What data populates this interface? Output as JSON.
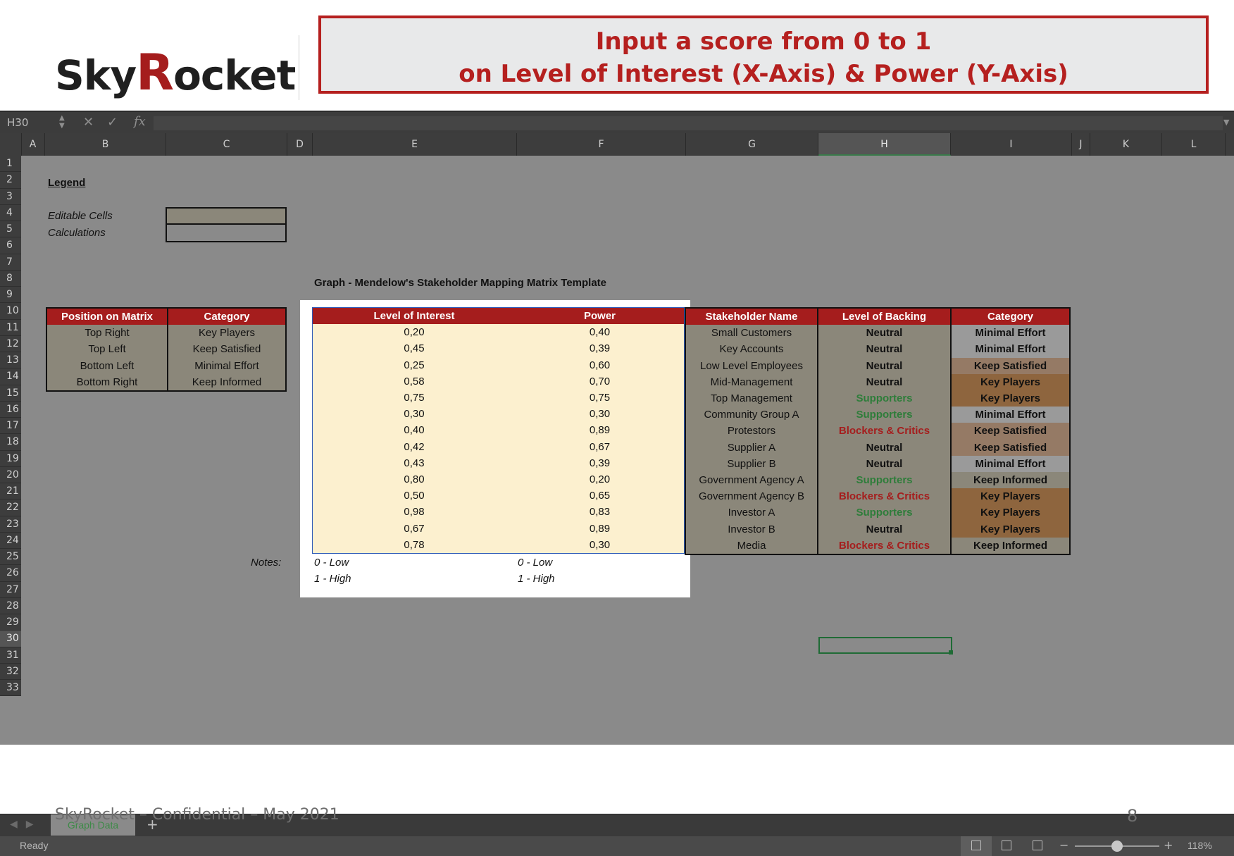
{
  "logo": {
    "pre": "Sky",
    "r": "R",
    "post": "ocket"
  },
  "banner": {
    "line1": "Input a score from 0 to 1",
    "line2": "on Level of Interest (X-Axis) & Power (Y-Axis)"
  },
  "formula_bar": {
    "name_box": "H30",
    "fx": "fx"
  },
  "columns": [
    "A",
    "B",
    "C",
    "D",
    "E",
    "F",
    "G",
    "H",
    "I",
    "J",
    "K",
    "L"
  ],
  "selected_column": "H",
  "rows": [
    "1",
    "2",
    "3",
    "4",
    "5",
    "6",
    "7",
    "8",
    "9",
    "10",
    "11",
    "12",
    "13",
    "14",
    "15",
    "16",
    "17",
    "18",
    "19",
    "20",
    "21",
    "22",
    "23",
    "24",
    "25",
    "26",
    "27",
    "28",
    "29",
    "30",
    "31",
    "32",
    "33"
  ],
  "selected_row": "30",
  "legend": {
    "title": "Legend",
    "editable": "Editable Cells",
    "calculations": "Calculations"
  },
  "graph_title": "Graph - Mendelow's Stakeholder Mapping Matrix Template",
  "matrix": {
    "headers": [
      "Position on Matrix",
      "Category"
    ],
    "rows": [
      [
        "Top Right",
        "Key Players"
      ],
      [
        "Top Left",
        "Keep Satisfied"
      ],
      [
        "Bottom Left",
        "Minimal Effort"
      ],
      [
        "Bottom Right",
        "Keep Informed"
      ]
    ]
  },
  "input": {
    "headers": [
      "Level of Interest",
      "Power"
    ],
    "rows": [
      [
        "0,20",
        "0,40"
      ],
      [
        "0,45",
        "0,39"
      ],
      [
        "0,25",
        "0,60"
      ],
      [
        "0,58",
        "0,70"
      ],
      [
        "0,75",
        "0,75"
      ],
      [
        "0,30",
        "0,30"
      ],
      [
        "0,40",
        "0,89"
      ],
      [
        "0,42",
        "0,67"
      ],
      [
        "0,43",
        "0,39"
      ],
      [
        "0,80",
        "0,20"
      ],
      [
        "0,50",
        "0,65"
      ],
      [
        "0,98",
        "0,83"
      ],
      [
        "0,67",
        "0,89"
      ],
      [
        "0,78",
        "0,30"
      ]
    ]
  },
  "notes": {
    "label": "Notes:",
    "e1": "0 - Low",
    "e2": "1 - High",
    "f1": "0 - Low",
    "f2": "1 - High"
  },
  "calc": {
    "headers": [
      "Stakeholder Name",
      "Level of Backing",
      "Category"
    ],
    "rows": [
      [
        "Small Customers",
        "Neutral",
        "Minimal Effort"
      ],
      [
        "Key Accounts",
        "Neutral",
        "Minimal Effort"
      ],
      [
        "Low Level Employees",
        "Neutral",
        "Keep Satisfied"
      ],
      [
        "Mid-Management",
        "Neutral",
        "Key Players"
      ],
      [
        "Top Management",
        "Supporters",
        "Key Players"
      ],
      [
        "Community Group A",
        "Supporters",
        "Minimal Effort"
      ],
      [
        "Protestors",
        "Blockers & Critics",
        "Keep Satisfied"
      ],
      [
        "Supplier A",
        "Neutral",
        "Keep Satisfied"
      ],
      [
        "Supplier B",
        "Neutral",
        "Minimal Effort"
      ],
      [
        "Government Agency A",
        "Supporters",
        "Keep Informed"
      ],
      [
        "Government Agency B",
        "Blockers & Critics",
        "Key Players"
      ],
      [
        "Investor A",
        "Supporters",
        "Key Players"
      ],
      [
        "Investor B",
        "Neutral",
        "Key Players"
      ],
      [
        "Media",
        "Blockers & Critics",
        "Keep Informed"
      ]
    ]
  },
  "sheet_tab": "Graph Data",
  "status": "Ready",
  "zoom": "118%",
  "footer": "SkyRocket – Confidential – May 2021",
  "page_number": "8",
  "colors": {
    "accent": "#b5201f",
    "header_fill": "#a51d1d",
    "input_fill": "#fcf0cf",
    "calc_fill": "#8b877a",
    "supporters": "#2e7d3a",
    "blockers": "#a51d1d"
  }
}
